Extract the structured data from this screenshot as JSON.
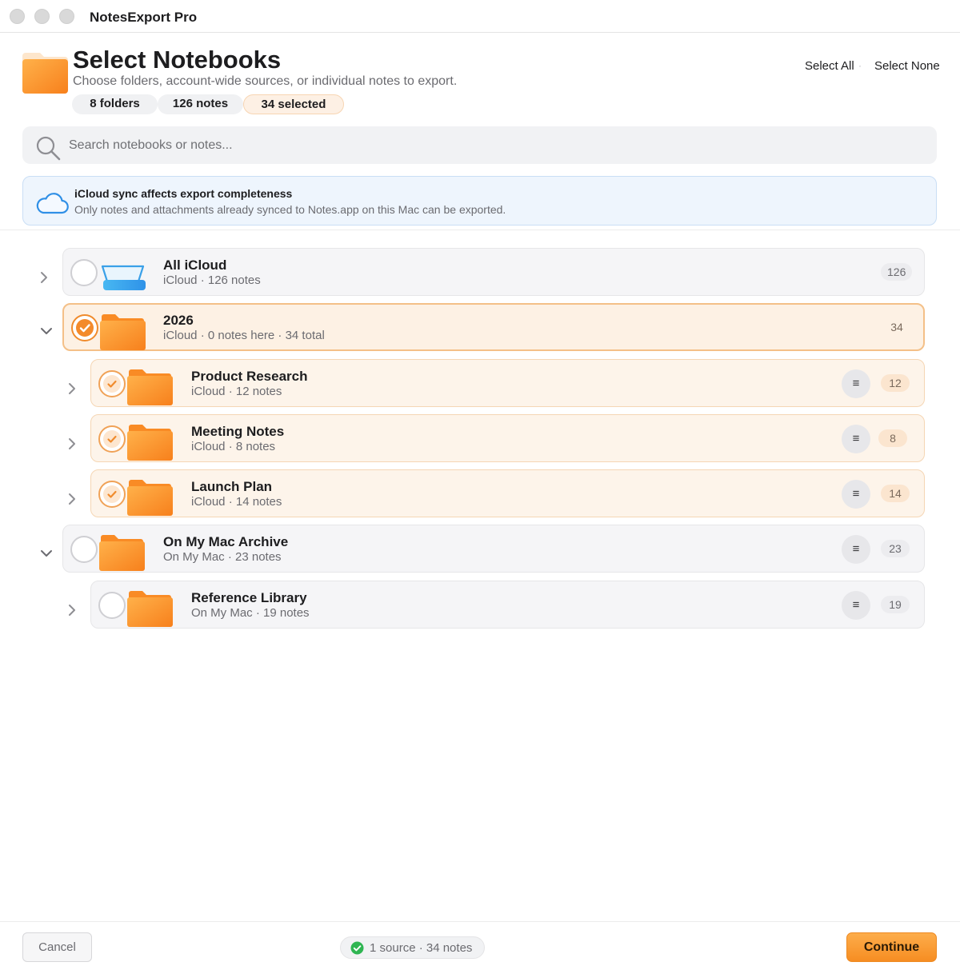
{
  "window": {
    "title": "NotesExport Pro"
  },
  "header": {
    "title": "Select Notebooks",
    "subtitle": "Choose folders, account-wide sources, or individual notes to export.",
    "stats": [
      "8 folders",
      "126 notes",
      "34 selected"
    ],
    "select_all": "Select All",
    "select_none": "Select None",
    "separator": "·"
  },
  "search": {
    "placeholder": "Search notebooks or notes...",
    "value": ""
  },
  "banner": {
    "title": "iCloud sync affects export completeness",
    "text": "Only notes and attachments already synced to Notes.app on this Mac can be exported."
  },
  "rows": [
    {
      "title": "All iCloud",
      "subtitle": "iCloud · 126 notes",
      "count": "126",
      "selected": false,
      "expanded": false,
      "icon": "icloud-tray-icon"
    },
    {
      "title": "2026",
      "subtitle": "iCloud · 0 notes here · 34 total",
      "count": "34",
      "selected": true,
      "expanded": true,
      "icon": "folder-icon"
    },
    {
      "title": "Product Research",
      "subtitle": "iCloud · 12 notes",
      "count": "12",
      "selected": true,
      "expanded": false,
      "icon": "folder-icon",
      "menu": "≡"
    },
    {
      "title": "Meeting Notes",
      "subtitle": "iCloud · 8 notes",
      "count": "8",
      "selected": true,
      "expanded": false,
      "icon": "folder-icon",
      "menu": "≡"
    },
    {
      "title": "Launch Plan",
      "subtitle": "iCloud · 14 notes",
      "count": "14",
      "selected": true,
      "expanded": false,
      "icon": "folder-icon",
      "menu": "≡"
    },
    {
      "title": "On My Mac Archive",
      "subtitle": "On My Mac · 23 notes",
      "count": "23",
      "selected": false,
      "expanded": true,
      "icon": "folder-icon",
      "menu": "≡"
    },
    {
      "title": "Reference Library",
      "subtitle": "On My Mac · 19 notes",
      "count": "19",
      "selected": false,
      "expanded": false,
      "icon": "folder-icon",
      "menu": "≡"
    }
  ],
  "footer": {
    "cancel": "Cancel",
    "status": "1 source · 34 notes",
    "continue": "Continue"
  },
  "colors": {
    "accent": "#f38a2b",
    "folder": "#fb9a3a",
    "icloud": "#3aa0e8",
    "success": "#2fb552"
  }
}
